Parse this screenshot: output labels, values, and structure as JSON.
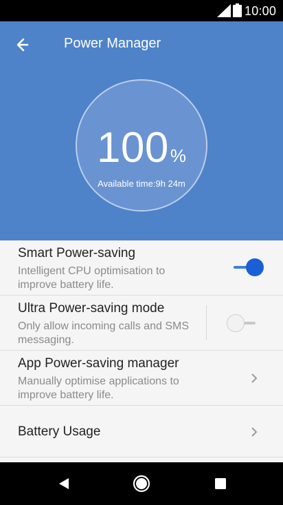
{
  "status_bar": {
    "time": "10:00"
  },
  "header": {
    "title": "Power Manager"
  },
  "battery_gauge": {
    "percent_value": "100",
    "percent_sign": "%",
    "available_time": "Available time:9h 24m"
  },
  "settings": [
    {
      "title": "Smart Power-saving",
      "description": "Intelligent CPU optimisation to improve battery life.",
      "toggle": "on"
    },
    {
      "title": "Ultra Power-saving mode",
      "description": "Only allow incoming calls and SMS messaging.",
      "toggle": "off"
    },
    {
      "title": "App Power-saving manager",
      "description": "Manually optimise applications to improve battery life.",
      "control": "chevron-right-icon"
    },
    {
      "title": "Battery Usage",
      "control": "chevron-right-icon"
    }
  ],
  "colors": {
    "header_blue": "#4e82c9",
    "gauge_fill": "#6a93d2",
    "toggle_on": "#1a5fd6"
  },
  "icons": {
    "back": "arrow-left-icon",
    "nav_back": "triangle-back-icon",
    "nav_home": "circle-home-icon",
    "nav_recents": "square-recents-icon"
  }
}
